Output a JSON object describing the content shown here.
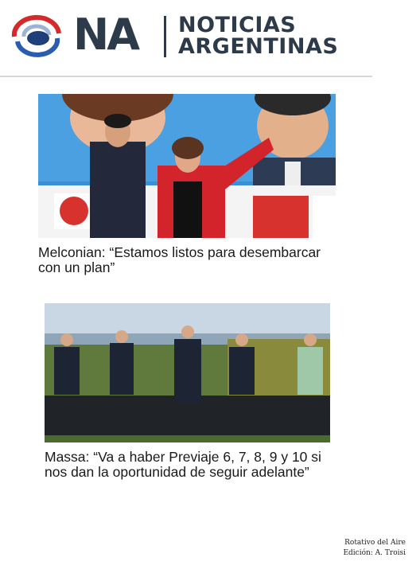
{
  "header": {
    "logo_text": "NA",
    "brand_line1": "NOTICIAS",
    "brand_line2": "ARGENTINAS"
  },
  "articles": [
    {
      "headline": "Melconian: “Estamos listos para desembarcar con un plan”"
    },
    {
      "headline": "Massa: “Va a haber Previaje 6, 7, 8, 9 y 10 si nos dan la oportunidad de seguir adelante”"
    }
  ],
  "footer": {
    "credit_line1": "Rotativo del Aire",
    "credit_line2": "Edición: A. Troisi"
  },
  "colors": {
    "brand_dark": "#2d3a4a",
    "logo_red": "#d42a2a",
    "logo_blue": "#2a5db0"
  }
}
